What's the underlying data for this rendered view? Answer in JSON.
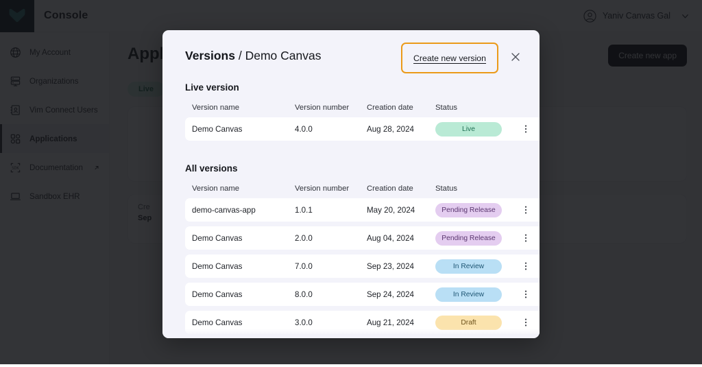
{
  "topbar": {
    "logo_name": "vim-heart-logo",
    "console_title": "Console",
    "user_name": "Yaniv Canvas Gal"
  },
  "sidebar": {
    "items": [
      {
        "label": "My Account",
        "icon": "globe-icon",
        "active": false,
        "external": false
      },
      {
        "label": "Organizations",
        "icon": "server-icon",
        "active": false,
        "external": false
      },
      {
        "label": "Vim Connect Users",
        "icon": "contact-book-icon",
        "active": false,
        "external": false
      },
      {
        "label": "Applications",
        "icon": "grid-icon",
        "active": true,
        "external": false
      },
      {
        "label": "Documentation",
        "icon": "sdk-icon",
        "active": false,
        "external": true
      },
      {
        "label": "Sandbox EHR",
        "icon": "laptop-icon",
        "active": false,
        "external": false
      }
    ]
  },
  "background_page": {
    "title": "Applications",
    "create_app_label": "Create new app",
    "live_filter_label": "Live",
    "card_line1": "Cre",
    "card_line2": "Sep"
  },
  "modal": {
    "title_main": "Versions",
    "title_separator": "/",
    "title_sub": "Demo Canvas",
    "create_version_label": "Create new version",
    "close_label": "×",
    "live_section_title": "Live version",
    "all_section_title": "All versions",
    "columns": [
      "Version name",
      "Version number",
      "Creation date",
      "Status"
    ],
    "live_versions": [
      {
        "name": "Demo Canvas",
        "number": "4.0.0",
        "date": "Aug 28, 2024",
        "status": "Live",
        "status_kind": "live"
      }
    ],
    "all_versions": [
      {
        "name": "demo-canvas-app",
        "number": "1.0.1",
        "date": "May 20, 2024",
        "status": "Pending Release",
        "status_kind": "pending"
      },
      {
        "name": "Demo Canvas",
        "number": "2.0.0",
        "date": "Aug 04, 2024",
        "status": "Pending Release",
        "status_kind": "pending"
      },
      {
        "name": "Demo Canvas",
        "number": "7.0.0",
        "date": "Sep 23, 2024",
        "status": "In Review",
        "status_kind": "review"
      },
      {
        "name": "Demo Canvas",
        "number": "8.0.0",
        "date": "Sep 24, 2024",
        "status": "In Review",
        "status_kind": "review"
      },
      {
        "name": "Demo Canvas",
        "number": "3.0.0",
        "date": "Aug 21, 2024",
        "status": "Draft",
        "status_kind": "draft"
      }
    ]
  },
  "colors": {
    "focus_ring": "#eb9a18",
    "modal_bg": "#f3f3fa",
    "status_live": "#b9ead5",
    "status_pending": "#e4cdf0",
    "status_review": "#b9dff5",
    "status_draft": "#fbe3ad",
    "logo_teal": "#2f7f83"
  }
}
